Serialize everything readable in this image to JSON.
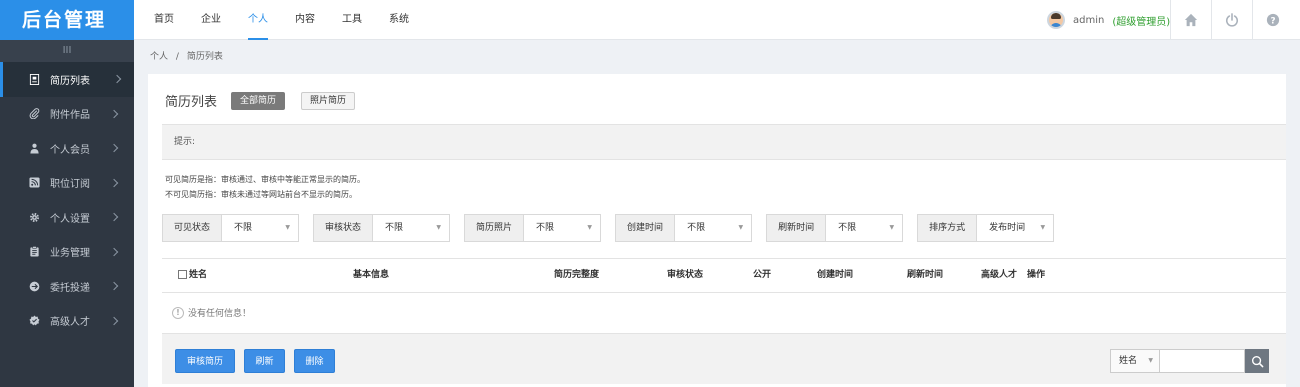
{
  "brand": {
    "logo_text": "后台管理"
  },
  "topnav": {
    "items": [
      {
        "label": "首页",
        "active": false
      },
      {
        "label": "企业",
        "active": false
      },
      {
        "label": "个人",
        "active": true
      },
      {
        "label": "内容",
        "active": false
      },
      {
        "label": "工具",
        "active": false
      },
      {
        "label": "系统",
        "active": false
      }
    ]
  },
  "user": {
    "name": "admin",
    "role": "(超级管理员)"
  },
  "top_icons": [
    "home-icon",
    "power-icon",
    "help-icon"
  ],
  "sidebar": {
    "toggle_label": "III",
    "items": [
      {
        "label": "简历列表",
        "icon": "resume-icon",
        "active": true
      },
      {
        "label": "附件作品",
        "icon": "attachment-icon",
        "active": false
      },
      {
        "label": "个人会员",
        "icon": "member-icon",
        "active": false
      },
      {
        "label": "职位订阅",
        "icon": "rss-icon",
        "active": false
      },
      {
        "label": "个人设置",
        "icon": "settings-icon",
        "active": false
      },
      {
        "label": "业务管理",
        "icon": "clipboard-icon",
        "active": false
      },
      {
        "label": "委托投递",
        "icon": "delivery-icon",
        "active": false
      },
      {
        "label": "高级人才",
        "icon": "badge-icon",
        "active": false
      }
    ]
  },
  "breadcrumb": {
    "parent": "个人",
    "separator": "/",
    "current": "简历列表"
  },
  "page": {
    "title": "简历列表",
    "tabs": [
      {
        "label": "全部简历",
        "active": true
      },
      {
        "label": "照片简历",
        "active": false
      }
    ]
  },
  "tip": {
    "label": "提示:"
  },
  "notes": [
    "可见简历是指：审核通过、审核中等能正常显示的简历。",
    "不可见简历指：审核未通过等网站前台不显示的简历。"
  ],
  "filters": [
    {
      "label": "可见状态",
      "value": "不限"
    },
    {
      "label": "审核状态",
      "value": "不限"
    },
    {
      "label": "简历照片",
      "value": "不限"
    },
    {
      "label": "创建时间",
      "value": "不限"
    },
    {
      "label": "刷新时间",
      "value": "不限"
    },
    {
      "label": "排序方式",
      "value": "发布时间"
    }
  ],
  "table": {
    "columns": [
      "姓名",
      "基本信息",
      "简历完整度",
      "审核状态",
      "公开",
      "创建时间",
      "刷新时间",
      "高级人才",
      "操作"
    ],
    "empty_message": "没有任何信息！"
  },
  "actions": {
    "review_label": "审核简历",
    "refresh_label": "刷新",
    "delete_label": "删除"
  },
  "search": {
    "type_label": "姓名",
    "value": ""
  },
  "colors": {
    "brand_blue": "#2b8fe8",
    "sidebar_bg": "#2f3742",
    "role_green": "#2e9e2e",
    "button_blue": "#3d8ee6"
  }
}
